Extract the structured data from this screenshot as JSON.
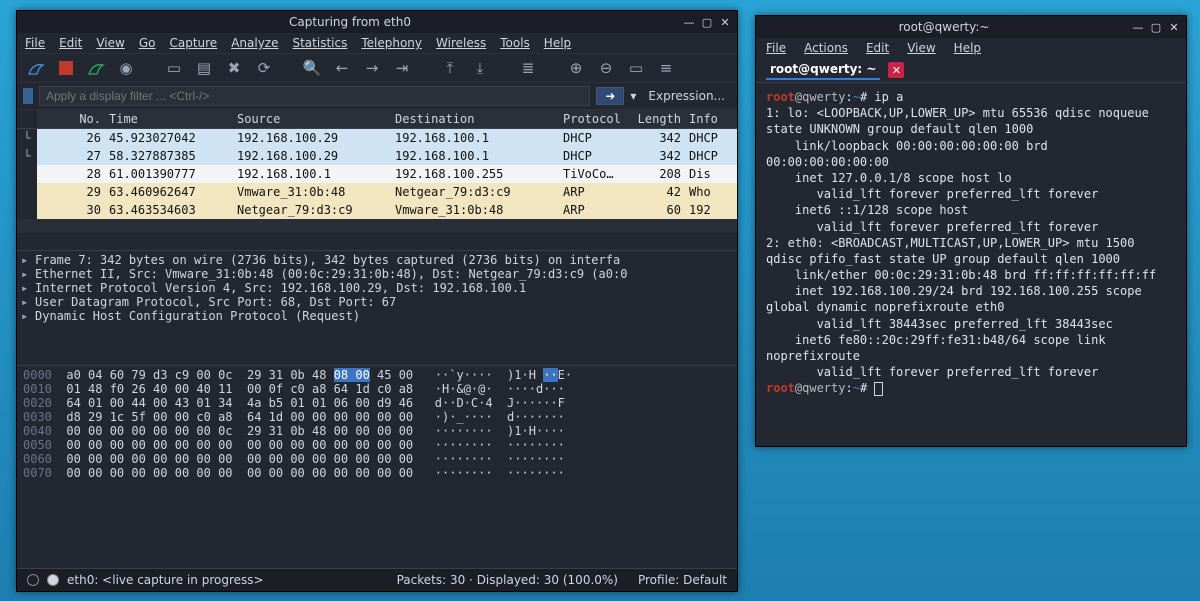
{
  "wireshark": {
    "title": "Capturing from eth0",
    "menu": [
      "File",
      "Edit",
      "View",
      "Go",
      "Capture",
      "Analyze",
      "Statistics",
      "Telephony",
      "Wireless",
      "Tools",
      "Help"
    ],
    "filter_placeholder": "Apply a display filter ... <Ctrl-/>",
    "expression_label": "Expression...",
    "columns": {
      "no": "No.",
      "time": "Time",
      "src": "Source",
      "dst": "Destination",
      "proto": "Protocol",
      "len": "Length",
      "info": "Info"
    },
    "rows": [
      {
        "no": "26",
        "time": "45.923027042",
        "src": "192.168.100.29",
        "dst": "192.168.100.1",
        "proto": "DHCP",
        "len": "342",
        "info": "DHCP",
        "cls": "r-blue",
        "mark": "└"
      },
      {
        "no": "27",
        "time": "58.327887385",
        "src": "192.168.100.29",
        "dst": "192.168.100.1",
        "proto": "DHCP",
        "len": "342",
        "info": "DHCP",
        "cls": "r-blue",
        "mark": "└"
      },
      {
        "no": "28",
        "time": "61.001390777",
        "src": "192.168.100.1",
        "dst": "192.168.100.255",
        "proto": "TiVoCo…",
        "len": "208",
        "info": "Dis",
        "cls": "r-white",
        "mark": ""
      },
      {
        "no": "29",
        "time": "63.460962647",
        "src": "Vmware_31:0b:48",
        "dst": "Netgear_79:d3:c9",
        "proto": "ARP",
        "len": "42",
        "info": "Who",
        "cls": "r-yellow",
        "mark": ""
      },
      {
        "no": "30",
        "time": "63.463534603",
        "src": "Netgear_79:d3:c9",
        "dst": "Vmware_31:0b:48",
        "proto": "ARP",
        "len": "60",
        "info": "192",
        "cls": "r-yellow",
        "mark": ""
      }
    ],
    "details": [
      "Frame 7: 342 bytes on wire (2736 bits), 342 bytes captured (2736 bits) on interfa",
      "Ethernet II, Src: Vmware_31:0b:48 (00:0c:29:31:0b:48), Dst: Netgear_79:d3:c9 (a0:0",
      "Internet Protocol Version 4, Src: 192.168.100.29, Dst: 192.168.100.1",
      "User Datagram Protocol, Src Port: 68, Dst Port: 67",
      "Dynamic Host Configuration Protocol (Request)"
    ],
    "hex": [
      {
        "off": "0000",
        "b": "a0 04 60 79 d3 c9 00 0c  29 31 0b 48 ",
        "hl": "08 00",
        "b2": " 45 00",
        "a": "   ··`y····  )1·H ",
        "ahl": "··",
        "a2": "E·"
      },
      {
        "off": "0010",
        "b": "01 48 f0 26 40 00 40 11  00 0f c0 a8 64 1d c0 a8",
        "hl": "",
        "b2": "",
        "a": "   ·H·&@·@·  ····d···",
        "ahl": "",
        "a2": ""
      },
      {
        "off": "0020",
        "b": "64 01 00 44 00 43 01 34  4a b5 01 01 06 00 d9 46",
        "hl": "",
        "b2": "",
        "a": "   d··D·C·4  J······F",
        "ahl": "",
        "a2": ""
      },
      {
        "off": "0030",
        "b": "d8 29 1c 5f 00 00 c0 a8  64 1d 00 00 00 00 00 00",
        "hl": "",
        "b2": "",
        "a": "   ·)·_····  d·······",
        "ahl": "",
        "a2": ""
      },
      {
        "off": "0040",
        "b": "00 00 00 00 00 00 00 0c  29 31 0b 48 00 00 00 00",
        "hl": "",
        "b2": "",
        "a": "   ········  )1·H····",
        "ahl": "",
        "a2": ""
      },
      {
        "off": "0050",
        "b": "00 00 00 00 00 00 00 00  00 00 00 00 00 00 00 00",
        "hl": "",
        "b2": "",
        "a": "   ········  ········",
        "ahl": "",
        "a2": ""
      },
      {
        "off": "0060",
        "b": "00 00 00 00 00 00 00 00  00 00 00 00 00 00 00 00",
        "hl": "",
        "b2": "",
        "a": "   ········  ········",
        "ahl": "",
        "a2": ""
      },
      {
        "off": "0070",
        "b": "00 00 00 00 00 00 00 00  00 00 00 00 00 00 00 00",
        "hl": "",
        "b2": "",
        "a": "   ········  ········",
        "ahl": "",
        "a2": ""
      }
    ],
    "status": {
      "iface": "eth0: <live capture in progress>",
      "packets": "Packets: 30 · Displayed: 30 (100.0%)",
      "profile": "Profile: Default"
    }
  },
  "terminal": {
    "title": "root@qwerty:~",
    "menu": [
      "File",
      "Actions",
      "Edit",
      "View",
      "Help"
    ],
    "tab": "root@qwerty: ~",
    "prompt": {
      "user": "root",
      "host": "@qwerty",
      "dir": "~",
      "sep": ":",
      "end": "# "
    },
    "cmd": "ip a",
    "output": "1: lo: <LOOPBACK,UP,LOWER_UP> mtu 65536 qdisc noqueue state UNKNOWN group default qlen 1000\n    link/loopback 00:00:00:00:00:00 brd 00:00:00:00:00:00\n    inet 127.0.0.1/8 scope host lo\n       valid_lft forever preferred_lft forever\n    inet6 ::1/128 scope host\n       valid_lft forever preferred_lft forever\n2: eth0: <BROADCAST,MULTICAST,UP,LOWER_UP> mtu 1500 qdisc pfifo_fast state UP group default qlen 1000\n    link/ether 00:0c:29:31:0b:48 brd ff:ff:ff:ff:ff:ff\n    inet 192.168.100.29/24 brd 192.168.100.255 scope global dynamic noprefixroute eth0\n       valid_lft 38443sec preferred_lft 38443sec\n    inet6 fe80::20c:29ff:fe31:b48/64 scope link noprefixroute\n       valid_lft forever preferred_lft forever"
  }
}
